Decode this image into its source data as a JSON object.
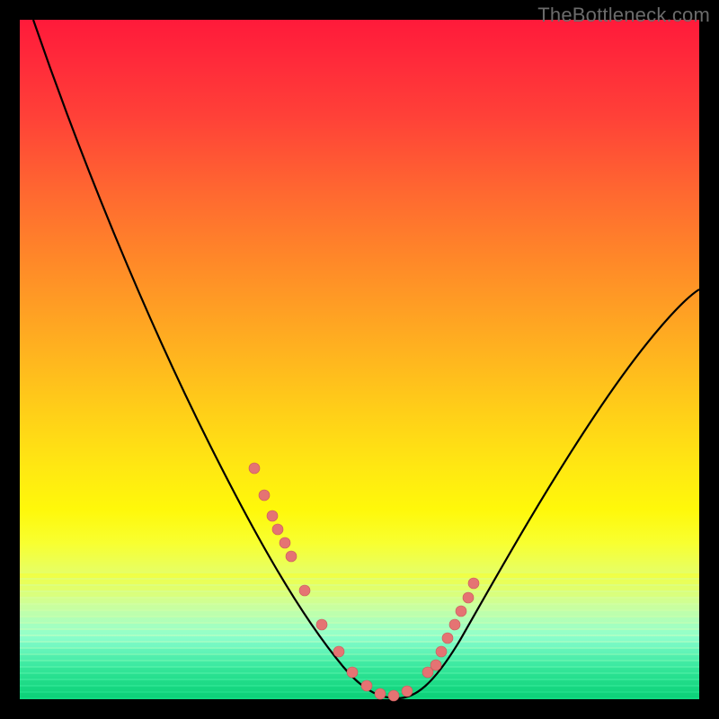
{
  "watermark": "TheBottleneck.com",
  "chart_data": {
    "type": "line",
    "title": "",
    "xlabel": "",
    "ylabel": "",
    "xlim": [
      0,
      100
    ],
    "ylim": [
      0,
      100
    ],
    "series": [
      {
        "name": "bottleneck-curve",
        "x": [
          2,
          8,
          14,
          20,
          26,
          32,
          36,
          40,
          43,
          46,
          49,
          52,
          55,
          58,
          62,
          66,
          70,
          74,
          78,
          83,
          88,
          93,
          98
        ],
        "y": [
          100,
          88,
          76,
          64,
          52,
          40,
          31,
          22,
          15,
          9,
          4,
          1,
          0,
          1,
          4,
          10,
          17,
          24,
          31,
          38,
          45,
          51,
          56
        ]
      }
    ],
    "markers": {
      "name": "highlight-dots",
      "x": [
        34.5,
        36,
        37.2,
        38,
        39,
        40,
        42,
        44.5,
        47,
        49,
        51,
        53,
        55,
        57,
        60,
        61.2,
        62,
        63,
        64,
        65,
        66,
        66.8
      ],
      "y": [
        34,
        30,
        27,
        25,
        23,
        21,
        16,
        11,
        7,
        4,
        2,
        0.8,
        0.5,
        1.2,
        4,
        5,
        7,
        9,
        11,
        13,
        15,
        17
      ]
    },
    "background_gradient": {
      "top": "#ff1a3a",
      "mid": "#ffe812",
      "bottom": "#10d880"
    }
  }
}
